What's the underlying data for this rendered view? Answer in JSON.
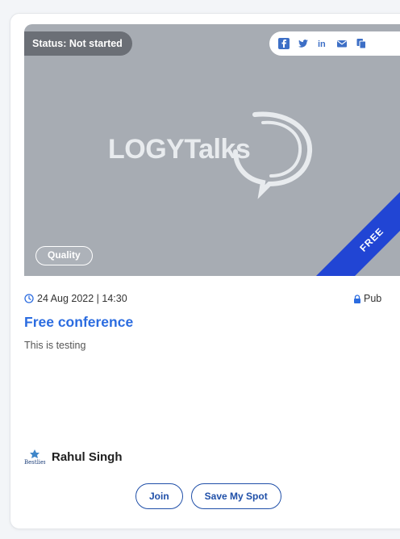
{
  "card": {
    "status_badge": "Status: Not started",
    "share_icons": [
      "facebook-icon",
      "twitter-icon",
      "linkedin-icon",
      "email-icon",
      "copy-icon"
    ],
    "banner_logo_text": "LOGYTalks",
    "ribbon_label": "FREE",
    "category_tag": "Quality",
    "date_time": "24 Aug 2022 | 14:30",
    "visibility": "Pub",
    "title": "Free conference",
    "description": "This is testing",
    "host_name": "Rahul Singh",
    "host_avatar_text": "Bestlier",
    "buttons": {
      "join": "Join",
      "save": "Save My Spot"
    }
  },
  "colors": {
    "accent_blue": "#2b6ce0",
    "ribbon_blue": "#2145d4",
    "banner_gray": "#a7acb3",
    "badge_gray": "#6b6f76",
    "button_border": "#1f4fa8"
  }
}
